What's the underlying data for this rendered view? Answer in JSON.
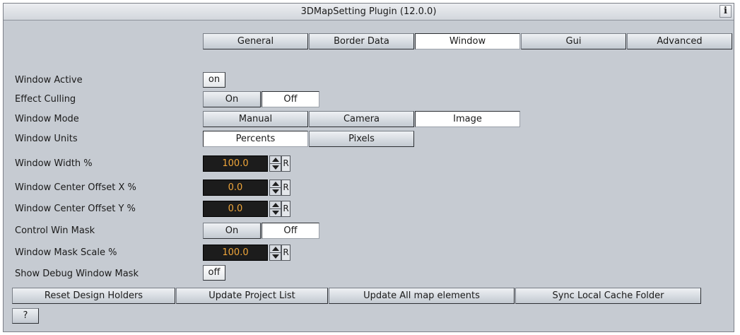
{
  "title": "3DMapSetting Plugin (12.0.0)",
  "info_label": "i",
  "tabs": [
    {
      "label": "General",
      "active": false
    },
    {
      "label": "Border Data",
      "active": false
    },
    {
      "label": "Window",
      "active": true
    },
    {
      "label": "Gui",
      "active": false
    },
    {
      "label": "Advanced",
      "active": false
    }
  ],
  "rows": {
    "window_active": {
      "label": "Window Active",
      "value": "on"
    },
    "effect_culling": {
      "label": "Effect Culling",
      "options": [
        "On",
        "Off"
      ],
      "selected": "Off"
    },
    "window_mode": {
      "label": "Window Mode",
      "options": [
        "Manual",
        "Camera",
        "Image"
      ],
      "selected": "Image"
    },
    "window_units": {
      "label": "Window Units",
      "options": [
        "Percents",
        "Pixels"
      ],
      "selected": "Percents"
    },
    "window_width": {
      "label": "Window Width %",
      "value": "100.0",
      "reset": "R"
    },
    "center_offset_x": {
      "label": "Window Center Offset X %",
      "value": "0.0",
      "reset": "R"
    },
    "center_offset_y": {
      "label": "Window Center Offset Y %",
      "value": "0.0",
      "reset": "R"
    },
    "control_win_mask": {
      "label": "Control Win Mask",
      "options": [
        "On",
        "Off"
      ],
      "selected": "Off"
    },
    "window_mask_scale": {
      "label": "Window Mask Scale %",
      "value": "100.0",
      "reset": "R"
    },
    "show_debug_mask": {
      "label": "Show Debug Window Mask",
      "value": "off"
    }
  },
  "actions": [
    "Reset Design Holders",
    "Update Project List",
    "Update All map elements",
    "Sync Local Cache Folder"
  ],
  "help_label": "?"
}
